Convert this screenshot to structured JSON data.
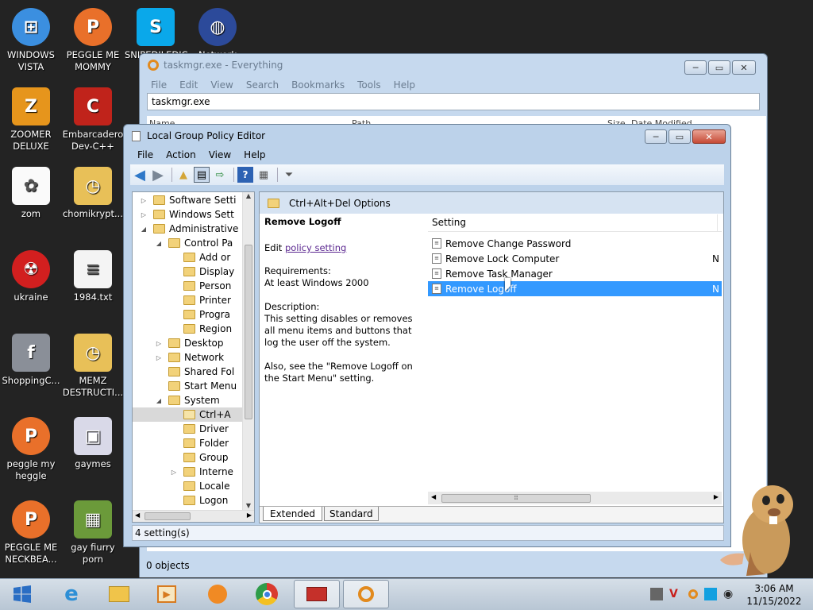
{
  "desktop": {
    "icons": [
      {
        "label": "WINDOWS VISTA",
        "icon": "vista-orb-icon"
      },
      {
        "label": "PEGGLE ME MOMMY",
        "icon": "peggle-icon"
      },
      {
        "label": "SNIPEDILEDIC GA",
        "icon": "skype-icon"
      },
      {
        "label": "Network",
        "icon": "network-globe-icon"
      },
      {
        "label": "ZOOMER DELUXE",
        "icon": "zoomer-icon"
      },
      {
        "label": "Embarcadero Dev-C++",
        "icon": "devcpp-icon"
      },
      {
        "label": "zom",
        "icon": "flower-icon"
      },
      {
        "label": "chomikrypt...",
        "icon": "clock-file-icon"
      },
      {
        "label": "ukraine",
        "icon": "radiation-icon"
      },
      {
        "label": "1984.txt",
        "icon": "text-file-icon"
      },
      {
        "label": "ShoppingC...",
        "icon": "flash-icon"
      },
      {
        "label": "MEMZ DESTRUCTI...",
        "icon": "clock-file-icon"
      },
      {
        "label": "peggle my heggle",
        "icon": "peggle-icon"
      },
      {
        "label": "gaymes",
        "icon": "folder-media-icon"
      },
      {
        "label": "PEGGLE ME NECKBEA...",
        "icon": "peggle-icon"
      },
      {
        "label": "gay fiurry porn",
        "icon": "gopher-box-icon"
      }
    ]
  },
  "everything": {
    "title": "taskmgr.exe - Everything",
    "menu": [
      "File",
      "Edit",
      "View",
      "Search",
      "Bookmarks",
      "Tools",
      "Help"
    ],
    "search_value": "taskmgr.exe",
    "columns": [
      "Name",
      "Path",
      "Size",
      "Date Modified"
    ],
    "status": "0 objects"
  },
  "gpedit": {
    "title": "Local Group Policy Editor",
    "menu": [
      "File",
      "Action",
      "View",
      "Help"
    ],
    "tree": [
      {
        "label": "Software Setti",
        "indent": 0,
        "exp": "right"
      },
      {
        "label": "Windows Sett",
        "indent": 0,
        "exp": "right"
      },
      {
        "label": "Administrative",
        "indent": 0,
        "exp": "down"
      },
      {
        "label": "Control Pa",
        "indent": 1,
        "exp": "down"
      },
      {
        "label": "Add or",
        "indent": 2,
        "exp": ""
      },
      {
        "label": "Display",
        "indent": 2,
        "exp": ""
      },
      {
        "label": "Person",
        "indent": 2,
        "exp": ""
      },
      {
        "label": "Printer",
        "indent": 2,
        "exp": ""
      },
      {
        "label": "Progra",
        "indent": 2,
        "exp": ""
      },
      {
        "label": "Region",
        "indent": 2,
        "exp": ""
      },
      {
        "label": "Desktop",
        "indent": 1,
        "exp": "right"
      },
      {
        "label": "Network",
        "indent": 1,
        "exp": "right"
      },
      {
        "label": "Shared Fol",
        "indent": 1,
        "exp": ""
      },
      {
        "label": "Start Menu",
        "indent": 1,
        "exp": ""
      },
      {
        "label": "System",
        "indent": 1,
        "exp": "down"
      },
      {
        "label": "Ctrl+A",
        "indent": 2,
        "exp": "",
        "selected": true
      },
      {
        "label": "Driver",
        "indent": 2,
        "exp": ""
      },
      {
        "label": "Folder",
        "indent": 2,
        "exp": ""
      },
      {
        "label": "Group",
        "indent": 2,
        "exp": ""
      },
      {
        "label": "Interne",
        "indent": 2,
        "exp": "right"
      },
      {
        "label": "Locale",
        "indent": 2,
        "exp": ""
      },
      {
        "label": "Logon",
        "indent": 2,
        "exp": ""
      }
    ],
    "node_header": "Ctrl+Alt+Del Options",
    "desc": {
      "title": "Remove Logoff",
      "edit_prefix": "Edit ",
      "edit_link": "policy setting",
      "req_label": "Requirements:",
      "req_value": "At least Windows 2000",
      "desc_label": "Description:",
      "desc_text": "This setting disables or removes all menu items and buttons that log the user off the system.",
      "also_text": "Also, see the \"Remove Logoff on the Start Menu\" setting."
    },
    "list_header": "Setting",
    "settings": [
      {
        "label": "Remove Change Password",
        "state": ""
      },
      {
        "label": "Remove Lock Computer",
        "state": "N"
      },
      {
        "label": "Remove Task Manager",
        "state": ""
      },
      {
        "label": "Remove Logoff",
        "state": "N",
        "selected": true
      }
    ],
    "tabs": [
      "Extended",
      "Standard"
    ],
    "status": "4 setting(s)"
  },
  "taskbar": {
    "time": "3:06 AM",
    "date": "11/15/2022"
  }
}
